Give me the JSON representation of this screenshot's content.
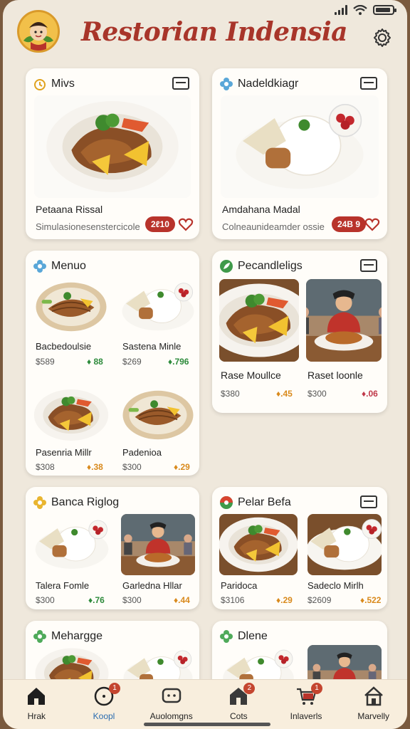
{
  "app": {
    "title": "Restorian Indensia"
  },
  "cards": [
    {
      "title": "Mivs",
      "dish_name": "Petaana Rissal",
      "dish_sub": "Simulasionesenstercicole",
      "price": "2ℓ10"
    },
    {
      "title": "Nadeldkiagr",
      "dish_name": "Amdahana Madal",
      "dish_sub": "Colneaunideamder ossie",
      "price": "24B 9"
    },
    {
      "title": "Menuo",
      "items": [
        {
          "name": "Bacbedoulsie",
          "price": "$589",
          "rating": "♦ 88"
        },
        {
          "name": "Sastena Minle",
          "price": "$269",
          "rating": "♦.796"
        },
        {
          "name": "Pasenria Millr",
          "price": "$308",
          "rating": "♦.38"
        },
        {
          "name": "Padenioa",
          "price": "$300",
          "rating": "♦.29"
        }
      ]
    },
    {
      "title": "Pecandleligs",
      "items": [
        {
          "name": "Rase Moullce",
          "price": "$380",
          "rating": "♦.45"
        },
        {
          "name": "Raset loonle",
          "price": "$300",
          "rating": "♦.06"
        }
      ]
    },
    {
      "title": "Banca Riglog",
      "items": [
        {
          "name": "Talera Fomle",
          "price": "$300",
          "rating": "♦.76"
        },
        {
          "name": "Garledna Hllar",
          "price": "$300",
          "rating": "♦.44"
        }
      ]
    },
    {
      "title": "Pelar Befa",
      "items": [
        {
          "name": "Paridoca",
          "price": "$3106",
          "rating": "♦.29"
        },
        {
          "name": "Sadeclo Mirlh",
          "price": "$2609",
          "rating": "♦.522"
        }
      ]
    },
    {
      "title": "Mehargge"
    },
    {
      "title": "Dlene"
    }
  ],
  "tabs": [
    {
      "label": "Hrak",
      "icon": "home-icon",
      "badge": ""
    },
    {
      "label": "Koopl",
      "icon": "clock-icon",
      "badge": "1"
    },
    {
      "label": "Auolomgns",
      "icon": "chat-icon",
      "badge": ""
    },
    {
      "label": "Cots",
      "icon": "store-icon",
      "badge": "2"
    },
    {
      "label": "Inlaverls",
      "icon": "cart-icon",
      "badge": "1"
    },
    {
      "label": "Marvelly",
      "icon": "house-icon",
      "badge": ""
    }
  ],
  "colors": {
    "accent": "#a8352a",
    "price_badge": "#b8332b",
    "background": "#efe8dc",
    "tab_active": "#2b6cb0"
  }
}
